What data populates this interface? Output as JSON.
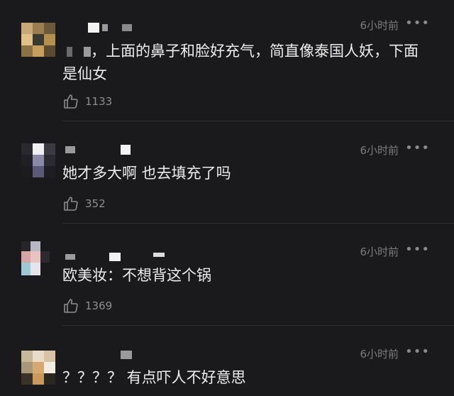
{
  "comments": [
    {
      "time": "6小时前",
      "text": "，上面的鼻子和脸好充气，简直像泰国人妖，下面是仙女",
      "likes": "1133"
    },
    {
      "time": "6小时前",
      "text": "她才多大啊 也去填充了吗",
      "likes": "352"
    },
    {
      "time": "6小时前",
      "text": "欧美妆：不想背这个锅",
      "likes": "1369"
    },
    {
      "time": "6小时前",
      "text": "？？？？ 有点吓人不好意思"
    }
  ],
  "icons": {
    "more": "more-dots-icon",
    "like": "thumbs-up-icon"
  },
  "colors": {
    "background": "#1a1a1c",
    "text": "#ededed",
    "meta": "#7c7c80"
  }
}
